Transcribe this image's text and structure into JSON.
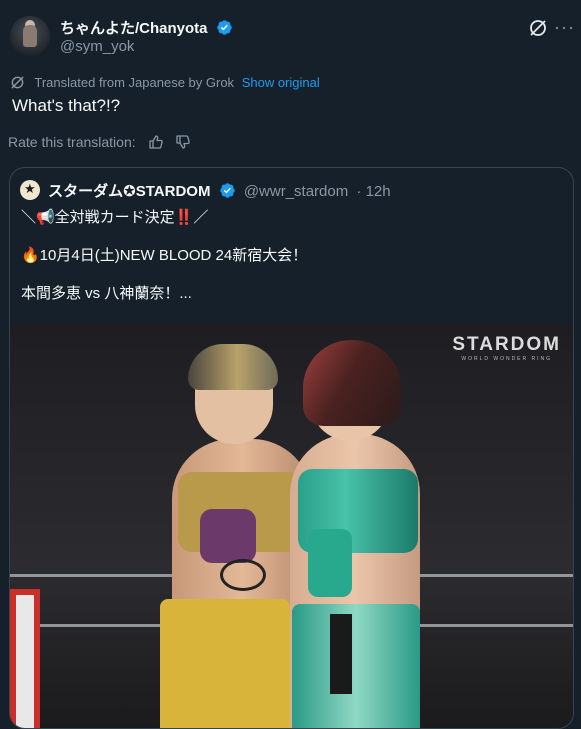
{
  "post": {
    "author_name": "ちゃんよた/Chanyota",
    "author_handle": "@sym_yok",
    "translated_label": "Translated from Japanese by Grok",
    "show_original_label": "Show original",
    "text": "What's that?!?",
    "rate_label": "Rate this translation:"
  },
  "quote": {
    "name": "スターダム✪STARDOM",
    "handle": "@wwr_stardom",
    "time": "· 12h",
    "lines": [
      "＼📢全対戦カード決定‼️／",
      "🔥10月4日(土)NEW BLOOD 24新宿大会！",
      "本間多恵 vs 八神蘭奈！..."
    ],
    "image_logo": "STARDOM",
    "image_logo_sub": "WORLD WONDER RING"
  },
  "colors": {
    "background": "#15202b",
    "accent": "#1d9bf0",
    "muted": "#8b98a5",
    "border": "#38444d"
  },
  "icons": {
    "verified": "verified-badge-icon",
    "grok": "grok-icon",
    "more": "more-icon",
    "translate": "translate-icon",
    "thumb_up": "thumbs-up-icon",
    "thumb_down": "thumbs-down-icon"
  }
}
